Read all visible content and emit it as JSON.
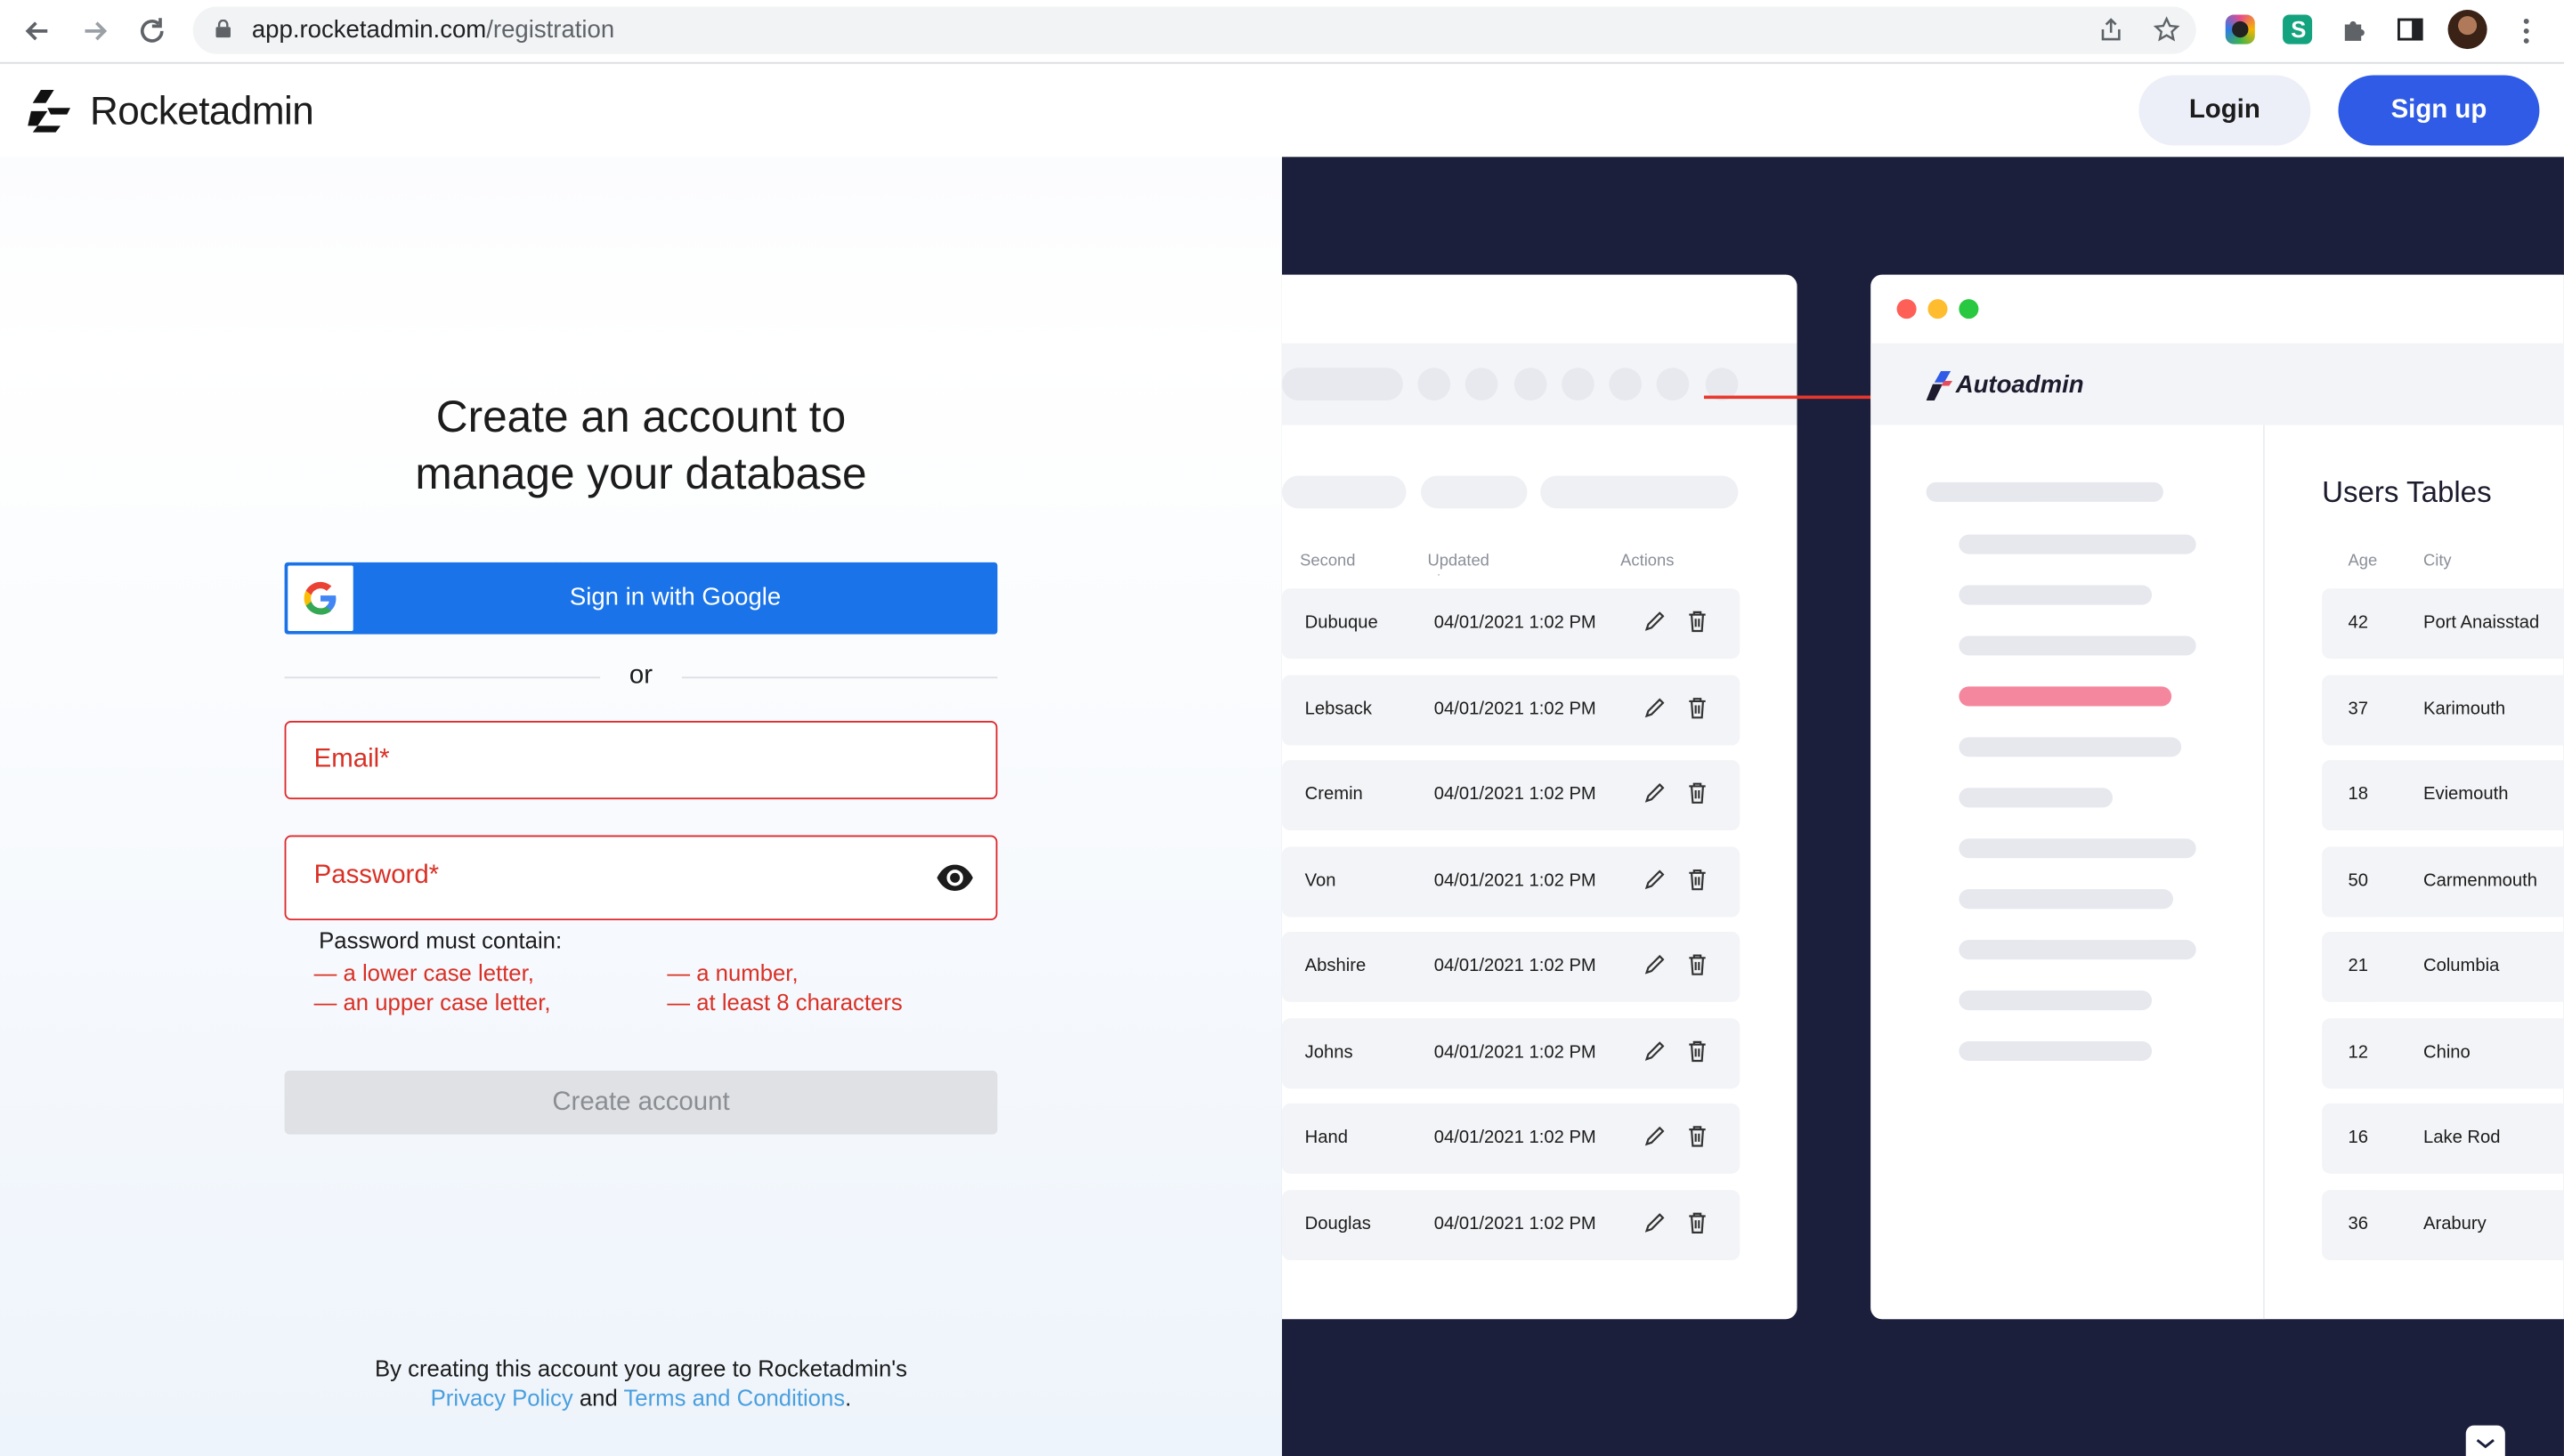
{
  "browser": {
    "url_host": "app.rocketadmin.com",
    "url_path": "/registration"
  },
  "header": {
    "brand": "Rocketadmin",
    "login_label": "Login",
    "signup_label": "Sign up"
  },
  "form": {
    "title_line1": "Create an account to",
    "title_line2": "manage your database",
    "google_label": "Sign in with Google",
    "or_label": "or",
    "email_placeholder": "Email*",
    "password_placeholder": "Password*",
    "hint_title": "Password must contain:",
    "hints": [
      "— a lower case letter,",
      "— an upper case letter,",
      "— a number,",
      "— at least 8 characters"
    ],
    "create_label": "Create account",
    "terms_text": "By creating this account you agree to Rocketadmin's",
    "privacy_link": "Privacy Policy",
    "and_text": "and",
    "terms_link": "Terms and Conditions",
    "period": "."
  },
  "showcase": {
    "left_table": {
      "headers": [
        "Second name",
        "Updated at",
        "Actions"
      ],
      "rows": [
        {
          "name": "Dubuque",
          "date": "04/01/2021 1:02 PM"
        },
        {
          "name": "Lebsack",
          "date": "04/01/2021 1:02 PM"
        },
        {
          "name": "Cremin",
          "date": "04/01/2021 1:02 PM"
        },
        {
          "name": "Von",
          "date": "04/01/2021 1:02 PM"
        },
        {
          "name": "Abshire",
          "date": "04/01/2021 1:02 PM"
        },
        {
          "name": "Johns",
          "date": "04/01/2021 1:02 PM"
        },
        {
          "name": "Hand",
          "date": "04/01/2021 1:02 PM"
        },
        {
          "name": "Douglas",
          "date": "04/01/2021 1:02 PM"
        }
      ]
    },
    "app_name": "Autoadmin",
    "users_title": "Users Tables",
    "users_table": {
      "headers": [
        "Age",
        "City"
      ],
      "rows": [
        {
          "age": "42",
          "city": "Port Anaisstad"
        },
        {
          "age": "37",
          "city": "Karimouth"
        },
        {
          "age": "18",
          "city": "Eviemouth"
        },
        {
          "age": "50",
          "city": "Carmenmouth"
        },
        {
          "age": "21",
          "city": "Columbia"
        },
        {
          "age": "12",
          "city": "Chino"
        },
        {
          "age": "16",
          "city": "Lake Rod"
        },
        {
          "age": "36",
          "city": "Arabury"
        }
      ]
    }
  },
  "colors": {
    "accent": "#2f5be6",
    "google_blue": "#1a73e8",
    "error": "#d93025",
    "panel_dark": "#1b1f3b",
    "highlight_pink": "#f4879d"
  }
}
